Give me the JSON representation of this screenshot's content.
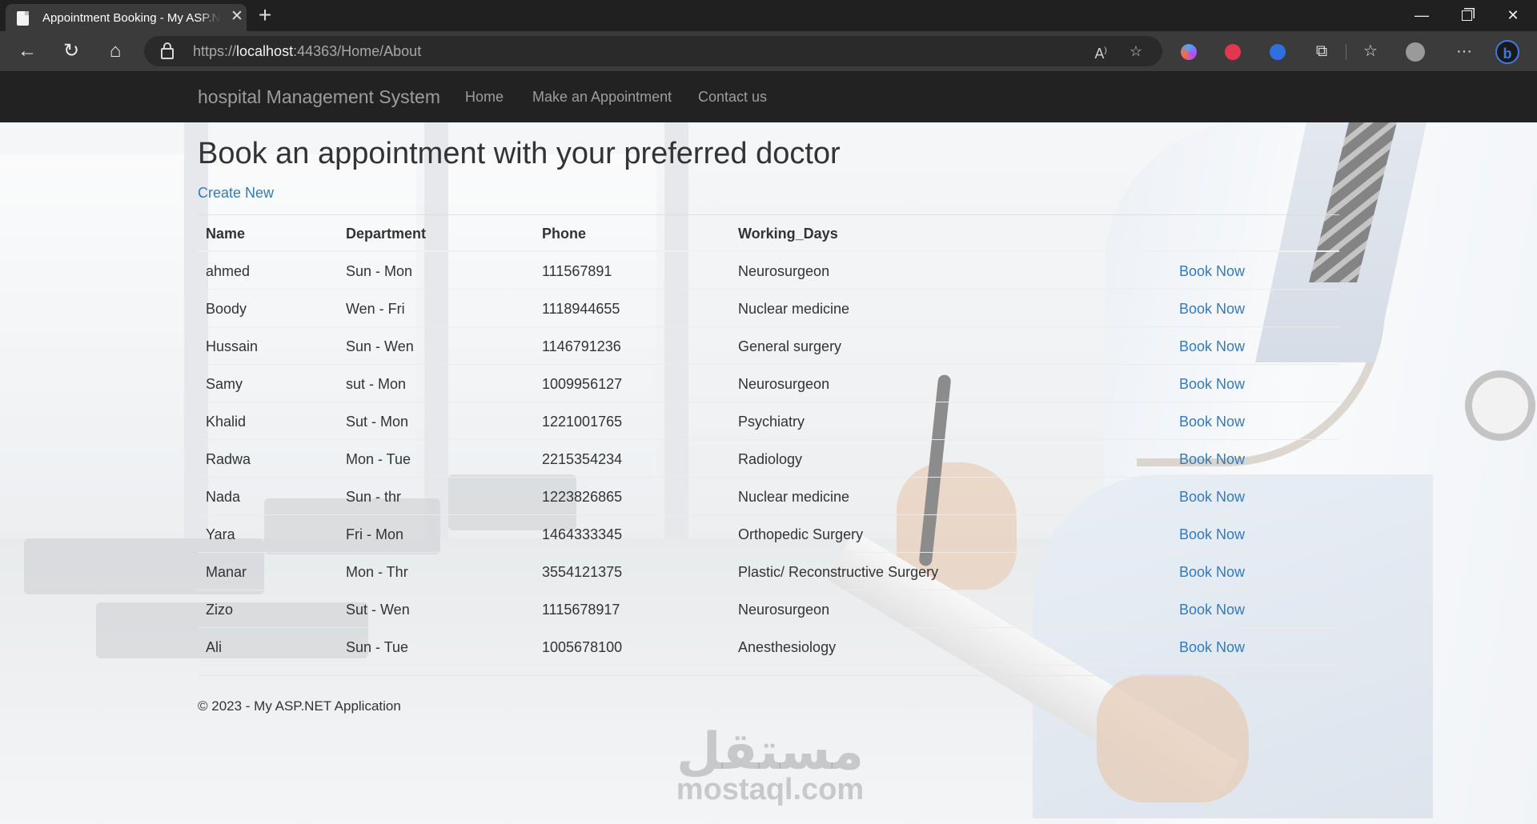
{
  "browser": {
    "tab_title": "Appointment Booking - My ASP.NET Application",
    "tab_close": "✕",
    "new_tab": "+",
    "url_prefix": "https://",
    "url_host": "localhost",
    "url_rest": ":44363/Home/About",
    "read_aloud_label": "A⁄"
  },
  "navbar": {
    "brand": "hospital Management System",
    "links": [
      "Home",
      "Make an Appointment",
      "Contact us"
    ]
  },
  "page": {
    "title": "Book an appointment with your preferred doctor",
    "create_new": "Create New"
  },
  "table": {
    "headers": [
      "Name",
      "Department",
      "Phone",
      "Working_Days"
    ],
    "rows": [
      {
        "name": "ahmed",
        "department": "Sun - Mon",
        "phone": "111567891",
        "working_days": "Neurosurgeon",
        "action": "Book Now"
      },
      {
        "name": "Boody",
        "department": "Wen - Fri",
        "phone": "1118944655",
        "working_days": "Nuclear medicine",
        "action": "Book Now"
      },
      {
        "name": "Hussain",
        "department": "Sun - Wen",
        "phone": "1146791236",
        "working_days": "General surgery",
        "action": "Book Now"
      },
      {
        "name": "Samy",
        "department": "sut - Mon",
        "phone": "1009956127",
        "working_days": "Neurosurgeon",
        "action": "Book Now"
      },
      {
        "name": "Khalid",
        "department": "Sut - Mon",
        "phone": "1221001765",
        "working_days": "Psychiatry",
        "action": "Book Now"
      },
      {
        "name": "Radwa",
        "department": "Mon - Tue",
        "phone": "2215354234",
        "working_days": "Radiology",
        "action": "Book Now"
      },
      {
        "name": "Nada",
        "department": "Sun - thr",
        "phone": "1223826865",
        "working_days": "Nuclear medicine",
        "action": "Book Now"
      },
      {
        "name": "Yara",
        "department": "Fri - Mon",
        "phone": "1464333345",
        "working_days": "Orthopedic Surgery",
        "action": "Book Now"
      },
      {
        "name": "Manar",
        "department": "Mon - Thr",
        "phone": "3554121375",
        "working_days": "Plastic/ Reconstructive Surgery",
        "action": "Book Now"
      },
      {
        "name": "Zizo",
        "department": "Sut - Wen",
        "phone": "1115678917",
        "working_days": "Neurosurgeon",
        "action": "Book Now"
      },
      {
        "name": "Ali",
        "department": "Sun - Tue",
        "phone": "1005678100",
        "working_days": "Anesthesiology",
        "action": "Book Now"
      }
    ]
  },
  "footer": {
    "text": "© 2023 - My ASP.NET Application"
  },
  "watermark": {
    "arabic": "مستقل",
    "latin": "mostaql.com"
  },
  "colors": {
    "link": "#337ab7",
    "navbar": "#222222",
    "nav_text": "#9d9d9d",
    "text": "#333333"
  },
  "icons": [
    "page-favicon",
    "back-arrow-icon",
    "reload-icon",
    "home-icon",
    "lock-icon",
    "read-aloud-icon",
    "add-favorite-icon",
    "copilot-ext-icon",
    "record-ext-icon",
    "translate-ext-icon",
    "extensions-icon",
    "favorites-icon",
    "profile-icon",
    "more-icon",
    "bing-icon"
  ]
}
